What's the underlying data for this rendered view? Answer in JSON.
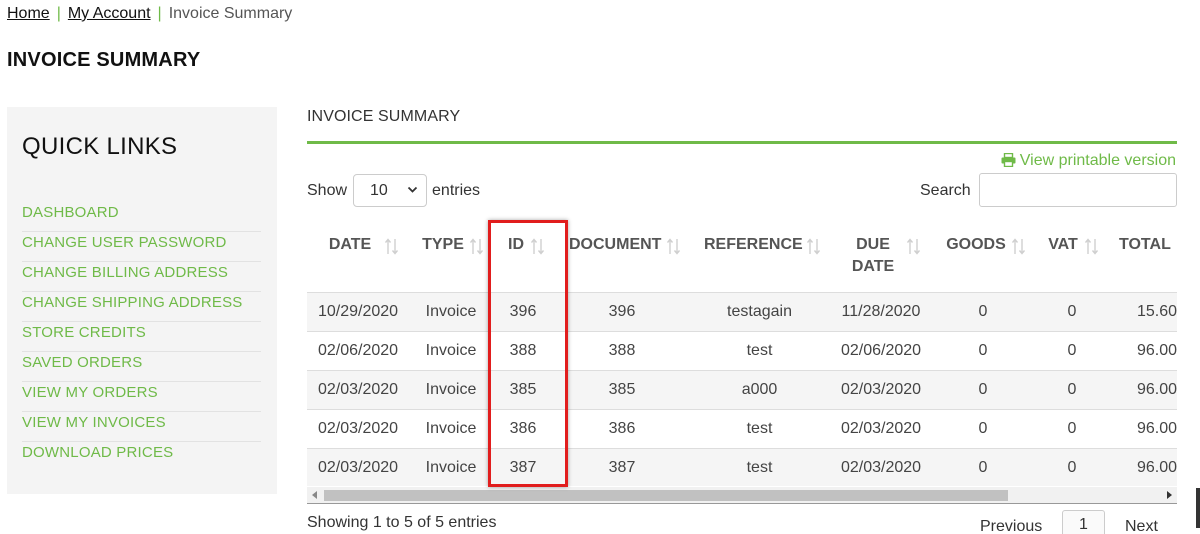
{
  "breadcrumb": {
    "home": "Home",
    "account": "My Account",
    "current": "Invoice Summary",
    "separator": "|"
  },
  "page_title": "INVOICE SUMMARY",
  "sidebar": {
    "title": "QUICK LINKS",
    "items": [
      "DASHBOARD",
      "CHANGE USER PASSWORD",
      "CHANGE BILLING ADDRESS",
      "CHANGE SHIPPING ADDRESS",
      "STORE CREDITS",
      "SAVED ORDERS",
      "VIEW MY ORDERS",
      "VIEW MY INVOICES",
      "DOWNLOAD PRICES"
    ]
  },
  "main": {
    "heading": "INVOICE SUMMARY",
    "printable_link": "View printable version",
    "show_label": "Show",
    "entries_label": "entries",
    "page_length": "10",
    "search_label": "Search",
    "search_value": ""
  },
  "table": {
    "headers": {
      "date": "DATE",
      "type": "TYPE",
      "id": "ID",
      "document": "DOCUMENT",
      "reference": "REFERENCE",
      "due_line1": "DUE",
      "due_line2": "DATE",
      "goods": "GOODS",
      "vat": "VAT",
      "total": "TOTAL"
    },
    "rows": [
      {
        "date": "10/29/2020",
        "type": "Invoice",
        "id": "396",
        "document": "396",
        "reference": "testagain",
        "due": "11/28/2020",
        "goods": "0",
        "vat": "0",
        "total": "15.60"
      },
      {
        "date": "02/06/2020",
        "type": "Invoice",
        "id": "388",
        "document": "388",
        "reference": "test",
        "due": "02/06/2020",
        "goods": "0",
        "vat": "0",
        "total": "96.00"
      },
      {
        "date": "02/03/2020",
        "type": "Invoice",
        "id": "385",
        "document": "385",
        "reference": "a000",
        "due": "02/03/2020",
        "goods": "0",
        "vat": "0",
        "total": "96.00"
      },
      {
        "date": "02/03/2020",
        "type": "Invoice",
        "id": "386",
        "document": "386",
        "reference": "test",
        "due": "02/03/2020",
        "goods": "0",
        "vat": "0",
        "total": "96.00"
      },
      {
        "date": "02/03/2020",
        "type": "Invoice",
        "id": "387",
        "document": "387",
        "reference": "test",
        "due": "02/03/2020",
        "goods": "0",
        "vat": "0",
        "total": "96.00"
      }
    ]
  },
  "footer": {
    "info": "Showing 1 to 5 of 5 entries",
    "previous": "Previous",
    "page": "1",
    "next": "Next"
  },
  "colors": {
    "accent_green": "#6fba48",
    "highlight_red": "#e11d1d",
    "text": "#333333"
  },
  "icons": [
    "printer-icon",
    "sort-both-icon",
    "chevron-down-icon",
    "scroll-left-arrow-icon",
    "scroll-right-arrow-icon"
  ]
}
